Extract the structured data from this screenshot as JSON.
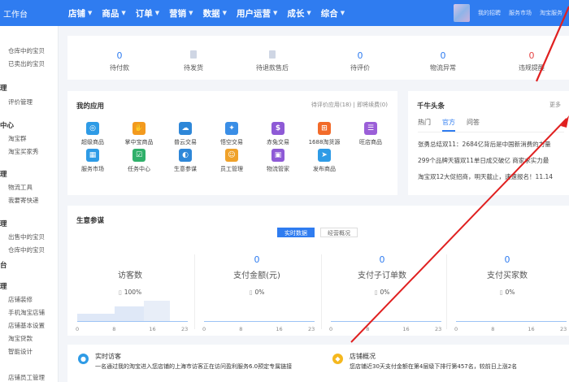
{
  "brand": {
    "name": "工作台"
  },
  "nav": {
    "items": [
      {
        "label": "店铺"
      },
      {
        "label": "商品"
      },
      {
        "label": "订单"
      },
      {
        "label": "营销"
      },
      {
        "label": "数据"
      },
      {
        "label": "用户运营"
      },
      {
        "label": "成长"
      },
      {
        "label": "综合"
      }
    ]
  },
  "sidebar": {
    "sections": [
      {
        "title": "",
        "items": [
          "仓库中的宝贝",
          "已卖出的宝贝"
        ]
      },
      {
        "title": "理",
        "items": [
          "评价管理"
        ]
      },
      {
        "title": "中心",
        "items": [
          "淘宝群",
          "淘宝买家秀"
        ]
      },
      {
        "title": "理",
        "items": [
          "物流工具",
          "我要寄快递"
        ]
      },
      {
        "title": "理",
        "items": [
          "出售中的宝贝",
          "仓库中的宝贝"
        ]
      },
      {
        "title": "台",
        "items": []
      },
      {
        "title": "理",
        "items": [
          "店铺装修",
          "手机淘宝店铺",
          "店铺基本设置",
          "淘宝贷款",
          "智能设计",
          "店铺员工管理"
        ]
      }
    ]
  },
  "stats": [
    {
      "value": "0",
      "label": "待付款",
      "hidden": false,
      "red": false
    },
    {
      "value": "",
      "label": "待发货",
      "hidden": true,
      "red": false
    },
    {
      "value": "",
      "label": "待退款售后",
      "hidden": true,
      "red": false
    },
    {
      "value": "0",
      "label": "待评价",
      "hidden": false,
      "red": false
    },
    {
      "value": "0",
      "label": "物流异常",
      "hidden": false,
      "red": false
    },
    {
      "value": "0",
      "label": "违规提醒",
      "hidden": false,
      "red": true
    }
  ],
  "apps": {
    "title": "我的应用",
    "pending_review": "待评价应用(18)",
    "renew": "即将续费(0)",
    "items": [
      {
        "label": "超级商品",
        "icon": "super-goods-icon",
        "color": "#2e9be6",
        "glyph": "◎"
      },
      {
        "label": "掌中宝商品",
        "icon": "palm-goods-icon",
        "color": "#f39a1e",
        "glyph": "✋"
      },
      {
        "label": "普云交易",
        "icon": "cloud-trade-icon",
        "color": "#2e87d8",
        "glyph": "☁"
      },
      {
        "label": "悟空交易",
        "icon": "wukong-trade-icon",
        "color": "#3a8ee6",
        "glyph": "✦"
      },
      {
        "label": "赤兔交易",
        "icon": "chitu-trade-icon",
        "color": "#8e5ad6",
        "glyph": "$"
      },
      {
        "label": "1688淘货源",
        "icon": "sourcing-icon",
        "color": "#f26b2a",
        "glyph": "⊞"
      },
      {
        "label": "旺店商品",
        "icon": "wangdian-goods-icon",
        "color": "#9b5fd8",
        "glyph": "☰"
      },
      {
        "label": "服务市场",
        "icon": "service-market-icon",
        "color": "#2e9be6",
        "glyph": "▦"
      },
      {
        "label": "任务中心",
        "icon": "task-center-icon",
        "color": "#2fb06a",
        "glyph": "☑"
      },
      {
        "label": "生意参谋",
        "icon": "business-advisor-icon",
        "color": "#2e87d8",
        "glyph": "◐"
      },
      {
        "label": "员工管理",
        "icon": "staff-icon",
        "color": "#f0a22a",
        "glyph": "☺"
      },
      {
        "label": "物流管家",
        "icon": "logistics-icon",
        "color": "#8e5ad6",
        "glyph": "▣"
      },
      {
        "label": "发布商品",
        "icon": "publish-icon",
        "color": "#2e9be6",
        "glyph": "➤"
      }
    ]
  },
  "news": {
    "title": "千牛头条",
    "more": "更多",
    "tabs": [
      "热门",
      "官方",
      "问答"
    ],
    "active_tab": 1,
    "lines": [
      "张勇总结双11：2684亿背后是中国新消费的力量",
      "299个品牌天猫双11单日成交破亿 商家求实力最",
      "淘宝双12大促招商，明天截止，速速报名！11.14"
    ]
  },
  "business": {
    "title": "生意参谋",
    "toggle_on": "实时数据",
    "toggle_off": "经营概况",
    "metrics": [
      {
        "value": "",
        "label": "访客数",
        "pct": "100%"
      },
      {
        "value": "0",
        "label": "支付金额(元)",
        "pct": "0%"
      },
      {
        "value": "0",
        "label": "支付子订单数",
        "pct": "0%"
      },
      {
        "value": "0",
        "label": "支付买家数",
        "pct": "0%"
      }
    ],
    "ticks": [
      "0",
      "8",
      "16",
      "23"
    ]
  },
  "bottom": {
    "left_title": "实时访客",
    "left_desc": "一名通过我的淘宝进入您店铺的上海市访客正在访问盈利服务6.0预定专属链接",
    "right_title": "店铺概况",
    "right_desc": "您店铺近30天支付金额在第4层级下排行第457名，较前日上涨2名",
    "left_color": "#2e9be6",
    "right_color": "#f5b81e"
  },
  "top": {
    "links": [
      "我的招聘",
      "服务市场",
      "淘宝服务"
    ]
  }
}
